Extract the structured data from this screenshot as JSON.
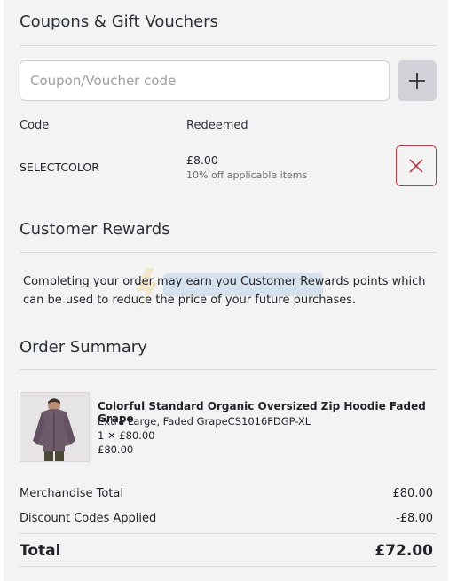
{
  "coupons": {
    "title": "Coupons & Gift Vouchers",
    "input_placeholder": "Coupon/Voucher code",
    "input_value": "",
    "add_icon": "plus-icon",
    "col_code": "Code",
    "col_redeemed": "Redeemed",
    "applied": [
      {
        "code": "SELECTCOLOR",
        "amount": "£8.00",
        "description": "10% off applicable items",
        "remove_icon": "close-icon"
      }
    ]
  },
  "rewards": {
    "title": "Customer Rewards",
    "text": "Completing your order may earn you Customer Rewards points which can be used to reduce the price of your future purchases."
  },
  "order_summary": {
    "title": "Order Summary",
    "items": [
      {
        "name": "Colorful Standard Organic Oversized Zip Hoodie Faded Grape",
        "variant": "Extra Large, Faded GrapeCS1016FDGP-XL",
        "qty_price": "1 ✕ £80.00",
        "line_total": "£80.00"
      }
    ],
    "merch_label": "Merchandise Total",
    "merch_value": "£80.00",
    "discount_label": "Discount Codes Applied",
    "discount_value": "-£8.00",
    "total_label": "Total",
    "total_value": "£72.00"
  },
  "colors": {
    "panel_bg": "#f3f3f4",
    "remove_border": "#b53a45",
    "hoodie": "#6d5b6a"
  }
}
